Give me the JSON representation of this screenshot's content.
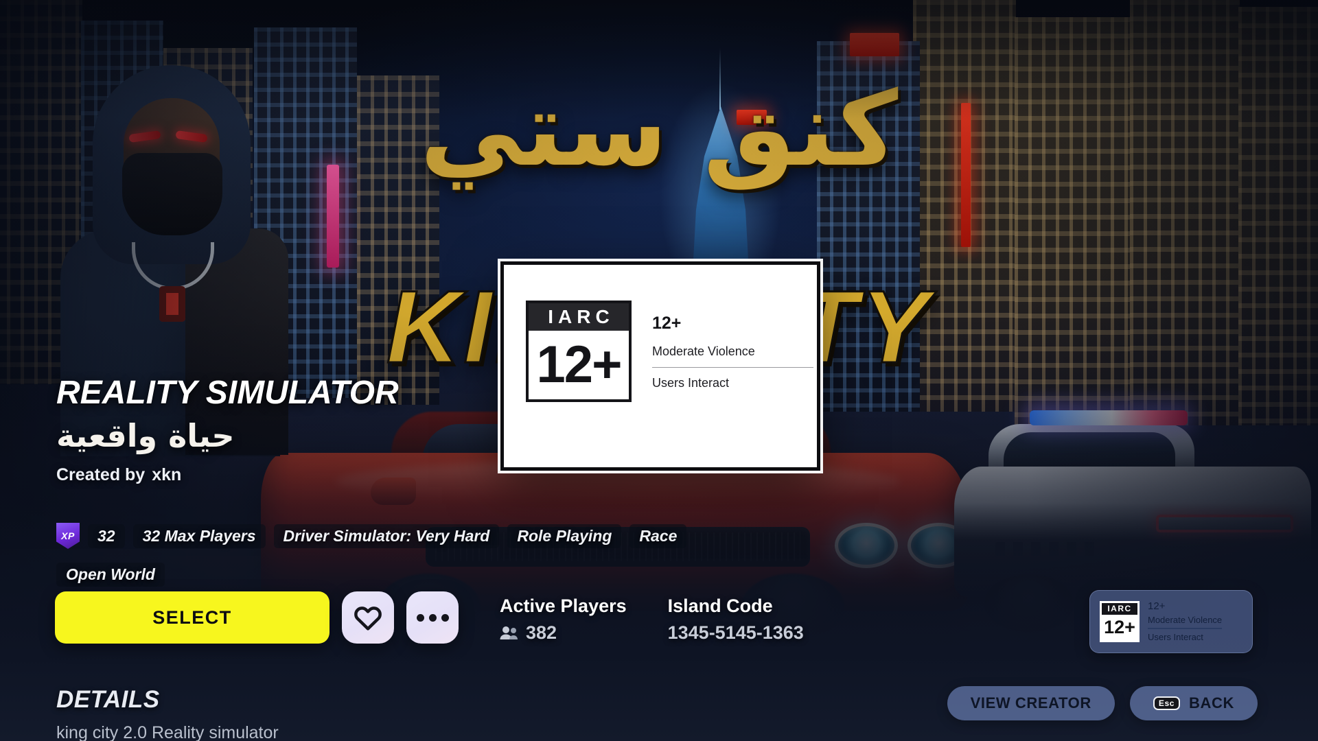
{
  "hero": {
    "arabic_logo": "كنق ستي",
    "latin_logo": "KING CITY"
  },
  "island": {
    "title": "REALITY SIMULATOR",
    "title_arabic": "حياة واقعية",
    "created_by_label": "Created by",
    "creator_name": "xkn",
    "xp_badge_label": "XP",
    "tags": [
      "32",
      "32 Max Players",
      "Driver Simulator: Very Hard",
      "Role Playing",
      "Race",
      "Open World"
    ]
  },
  "actions": {
    "select_label": "SELECT",
    "favorite_icon": "heart-icon",
    "more_icon": "ellipsis-icon"
  },
  "stats": {
    "active_players_label": "Active Players",
    "active_players_value": "382",
    "players_icon": "people-icon",
    "island_code_label": "Island Code",
    "island_code_value": "1345-5145-1363"
  },
  "rating_modal": {
    "mark_top": "IARC",
    "mark_age": "12+",
    "age": "12+",
    "descriptor_1": "Moderate Violence",
    "descriptor_2": "Users Interact"
  },
  "rating_badge": {
    "mark_top": "IARC",
    "mark_age": "12+",
    "age": "12+",
    "descriptor_1": "Moderate Violence",
    "descriptor_2": "Users Interact"
  },
  "details": {
    "heading": "DETAILS",
    "body": "king city 2.0 Reality simulator"
  },
  "footer": {
    "view_creator_label": "VIEW CREATOR",
    "back_label": "BACK",
    "back_key": "Esc"
  },
  "colors": {
    "select_yellow": "#f7f61e",
    "icon_button": "#e7e3f8",
    "footer_button": "rgba(122,146,206,.58)",
    "logo_gold": "#e3b52f",
    "page_background": "#131a2b"
  }
}
